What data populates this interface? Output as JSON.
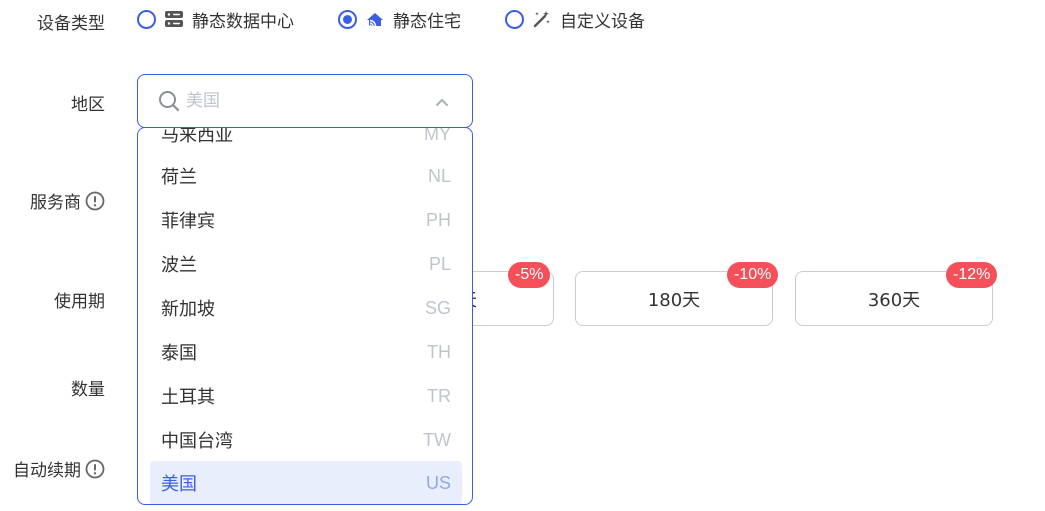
{
  "form": {
    "device_type_label": "设备类型",
    "region_label": "地区",
    "provider_label": "服务商",
    "period_label": "使用期",
    "quantity_label": "数量",
    "auto_renew_label": "自动续期"
  },
  "device_types": [
    {
      "label": "静态数据中心",
      "icon": "server-icon",
      "checked": false
    },
    {
      "label": "静态住宅",
      "icon": "residential-signal-icon",
      "checked": true
    },
    {
      "label": "自定义设备",
      "icon": "magic-wand-icon",
      "checked": false
    }
  ],
  "region": {
    "placeholder": "美国",
    "options": [
      {
        "name": "马来西亚",
        "code": "MY"
      },
      {
        "name": "荷兰",
        "code": "NL"
      },
      {
        "name": "菲律宾",
        "code": "PH"
      },
      {
        "name": "波兰",
        "code": "PL"
      },
      {
        "name": "新加坡",
        "code": "SG"
      },
      {
        "name": "泰国",
        "code": "TH"
      },
      {
        "name": "土耳其",
        "code": "TR"
      },
      {
        "name": "中国台湾",
        "code": "TW"
      },
      {
        "name": "美国",
        "code": "US",
        "selected": true
      }
    ]
  },
  "periods": [
    {
      "label": "天",
      "discount": "-5%"
    },
    {
      "label": "180天",
      "discount": "-10%"
    },
    {
      "label": "360天",
      "discount": "-12%"
    }
  ],
  "colors": {
    "accent": "#3b5ee7",
    "badge": "#f5505a",
    "selected_bg": "#e8eefb"
  }
}
